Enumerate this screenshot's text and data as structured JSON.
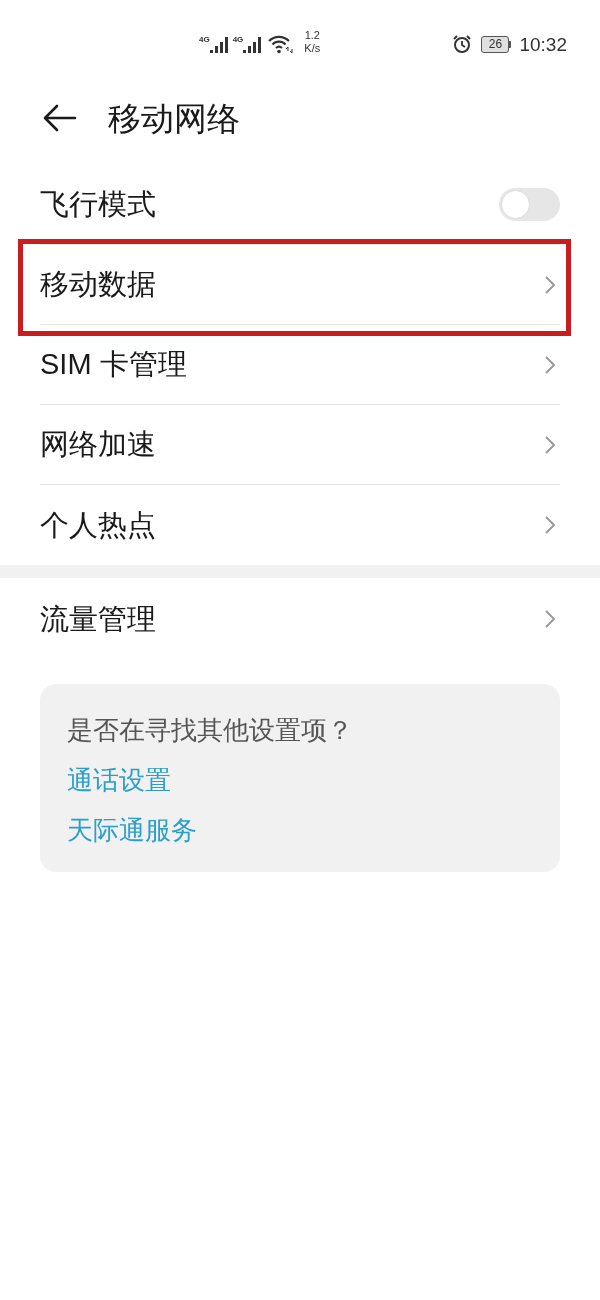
{
  "status_bar": {
    "signals": [
      {
        "network": "4G"
      },
      {
        "network": "4G"
      }
    ],
    "speed": "1.2",
    "speed_unit": "K/s",
    "battery": "26",
    "time": "10:32"
  },
  "header": {
    "title": "移动网络"
  },
  "sections": [
    {
      "items": [
        {
          "kind": "toggle",
          "label": "飞行模式",
          "on": false,
          "highlighted": false
        },
        {
          "kind": "link",
          "label": "移动数据",
          "highlighted": true
        },
        {
          "kind": "link",
          "label": "SIM 卡管理",
          "highlighted": false
        },
        {
          "kind": "link",
          "label": "网络加速",
          "highlighted": false
        },
        {
          "kind": "link",
          "label": "个人热点",
          "highlighted": false
        }
      ]
    },
    {
      "items": [
        {
          "kind": "link",
          "label": "流量管理",
          "highlighted": false
        }
      ]
    }
  ],
  "suggestions": {
    "prompt": "是否在寻找其他设置项？",
    "links": [
      "通话设置",
      "天际通服务"
    ]
  }
}
